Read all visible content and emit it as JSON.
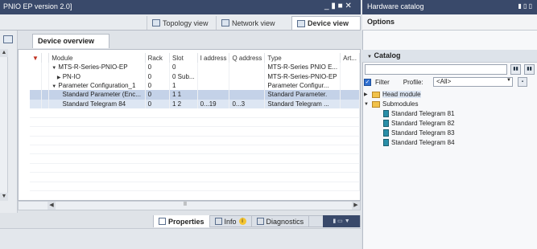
{
  "editor": {
    "title": "PNIO EP version 2.0]",
    "win_ctrls": "_ ▮ ■ ✕",
    "view_tabs": [
      "Topology view",
      "Network view",
      "Device view"
    ],
    "device_overview_tab": "Device overview"
  },
  "table": {
    "headers": [
      "Module",
      "Rack",
      "Slot",
      "I address",
      "Q address",
      "Type",
      "Art..."
    ],
    "rows": [
      {
        "module": "MTS-R-Series-PNIO-EP",
        "rack": "0",
        "slot": "0",
        "i": "",
        "q": "",
        "type": "MTS-R-Series PNIO E..."
      },
      {
        "module": "PN-IO",
        "rack": "0",
        "slot": "0 Sub...",
        "i": "",
        "q": "",
        "type": "MTS-R-Series-PNIO-EP"
      },
      {
        "module": "Parameter Configuration_1",
        "rack": "0",
        "slot": "1",
        "i": "",
        "q": "",
        "type": "Parameter Configur..."
      },
      {
        "module": "Standard Parameter (Enc...",
        "rack": "0",
        "slot": "1 1",
        "i": "",
        "q": "",
        "type": "Standard Parameter."
      },
      {
        "module": "Standard Telegram 84",
        "rack": "0",
        "slot": "1 2",
        "i": "0...19",
        "q": "0...3",
        "type": "Standard Telegram ..."
      }
    ]
  },
  "inspector": {
    "properties": "Properties",
    "info": "Info",
    "diagnostics": "Diagnostics"
  },
  "catalog": {
    "title": "Hardware catalog",
    "options": "Options",
    "catalog_label": "Catalog",
    "search_value": "",
    "filter_label": "Filter",
    "profile_label": "Profile:",
    "profile_value": "<All>",
    "tree": {
      "head_module": "Head module",
      "submodules": "Submodules",
      "items": [
        "Standard Telegram 81",
        "Standard Telegram 82",
        "Standard Telegram 83",
        "Standard Telegram 84"
      ]
    }
  }
}
